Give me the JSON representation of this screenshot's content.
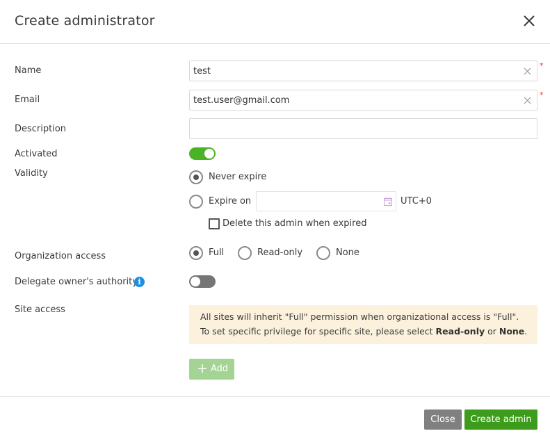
{
  "dialog": {
    "title": "Create administrator"
  },
  "form": {
    "name": {
      "label": "Name",
      "value": "test",
      "required_mark": "*"
    },
    "email": {
      "label": "Email",
      "value": "test.user@gmail.com",
      "required_mark": "*"
    },
    "description": {
      "label": "Description",
      "value": ""
    },
    "activated": {
      "label": "Activated",
      "on": true
    },
    "validity": {
      "label": "Validity",
      "never_expire_label": "Never expire",
      "expire_on_label": "Expire on",
      "selected": "never_expire",
      "date_value": "",
      "timezone": "UTC+0",
      "delete_when_expired_label": "Delete this admin when expired",
      "delete_when_expired_checked": false
    },
    "organization_access": {
      "label": "Organization access",
      "options": [
        "Full",
        "Read-only",
        "None"
      ],
      "selected": "Full"
    },
    "delegate": {
      "label": "Delegate owner's authority",
      "on": false,
      "info_icon": "i"
    },
    "site_access": {
      "label": "Site access",
      "notice_line1": "All sites will inherit \"Full\" permission when organizational access is \"Full\".",
      "notice_line2_prefix": "To set specific privilege for specific site, please select ",
      "notice_bold1": "Read-only",
      "notice_or": " or ",
      "notice_bold2": "None",
      "notice_end": ".",
      "add_label": "Add"
    }
  },
  "footer": {
    "close_label": "Close",
    "create_label": "Create admin"
  },
  "colors": {
    "accent_green": "#3e9c1c",
    "toggle_on": "#4bb227",
    "notice_bg": "#fbf1dc",
    "info_blue": "#1a8fe3",
    "required_red": "#e8332e"
  }
}
